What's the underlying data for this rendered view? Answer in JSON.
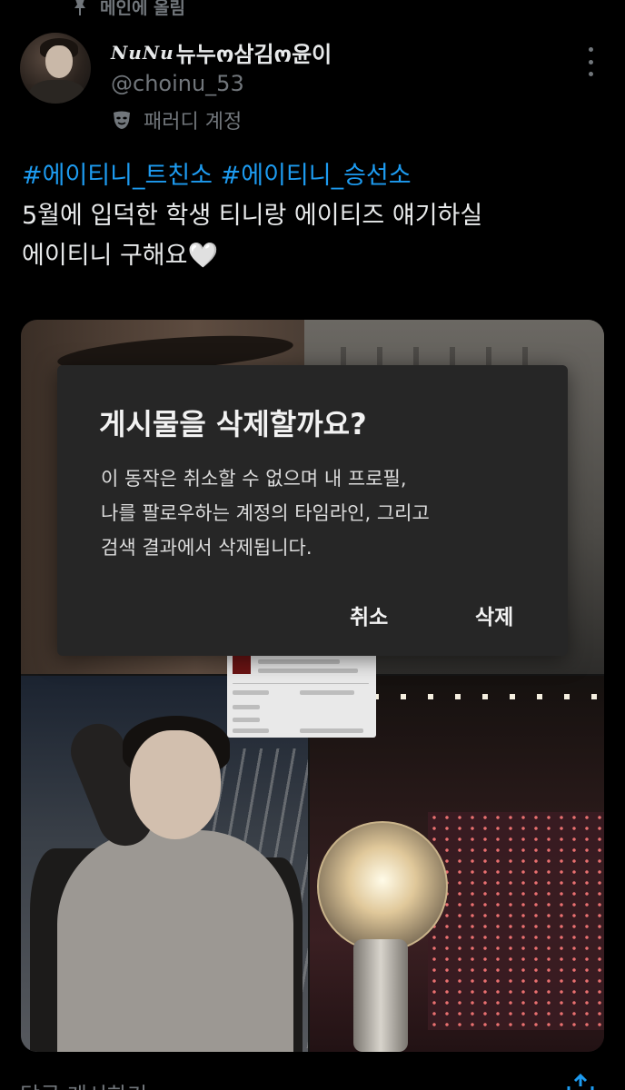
{
  "pinned": {
    "label": "메인에 올림"
  },
  "user": {
    "display_name_script": "NuNu",
    "display_name": "뉴누ო삼김ო윤이",
    "handle": "@choinu_53",
    "account_label": "패러디 계정"
  },
  "tweet": {
    "hashtag1": "#에이티니_트친소",
    "hashtag2": "#에이티니_승선소",
    "line1": "5월에 입덕한 학생 티니랑 에이티즈 얘기하실",
    "line2": "에이티니 구해요",
    "heart": "🤍"
  },
  "dialog": {
    "title": "게시물을 삭제할까요?",
    "body_line1": "이 동작은 취소할 수 없으며 내 프로필,",
    "body_line2": "나를 팔로우하는 계정의 타임라인, 그리고",
    "body_line3": "검색 결과에서 삭제됩니다.",
    "cancel_label": "취소",
    "delete_label": "삭제"
  },
  "footer": {
    "text": "답글 게시하기"
  },
  "icons": {
    "pin": "pin-icon",
    "more": "more-vertical-icon",
    "parody": "mask-icon",
    "share": "share-icon"
  },
  "colors": {
    "background": "#000000",
    "hashtag": "#1d9bf0",
    "muted": "#71767b",
    "dialog_bg": "#262626"
  }
}
